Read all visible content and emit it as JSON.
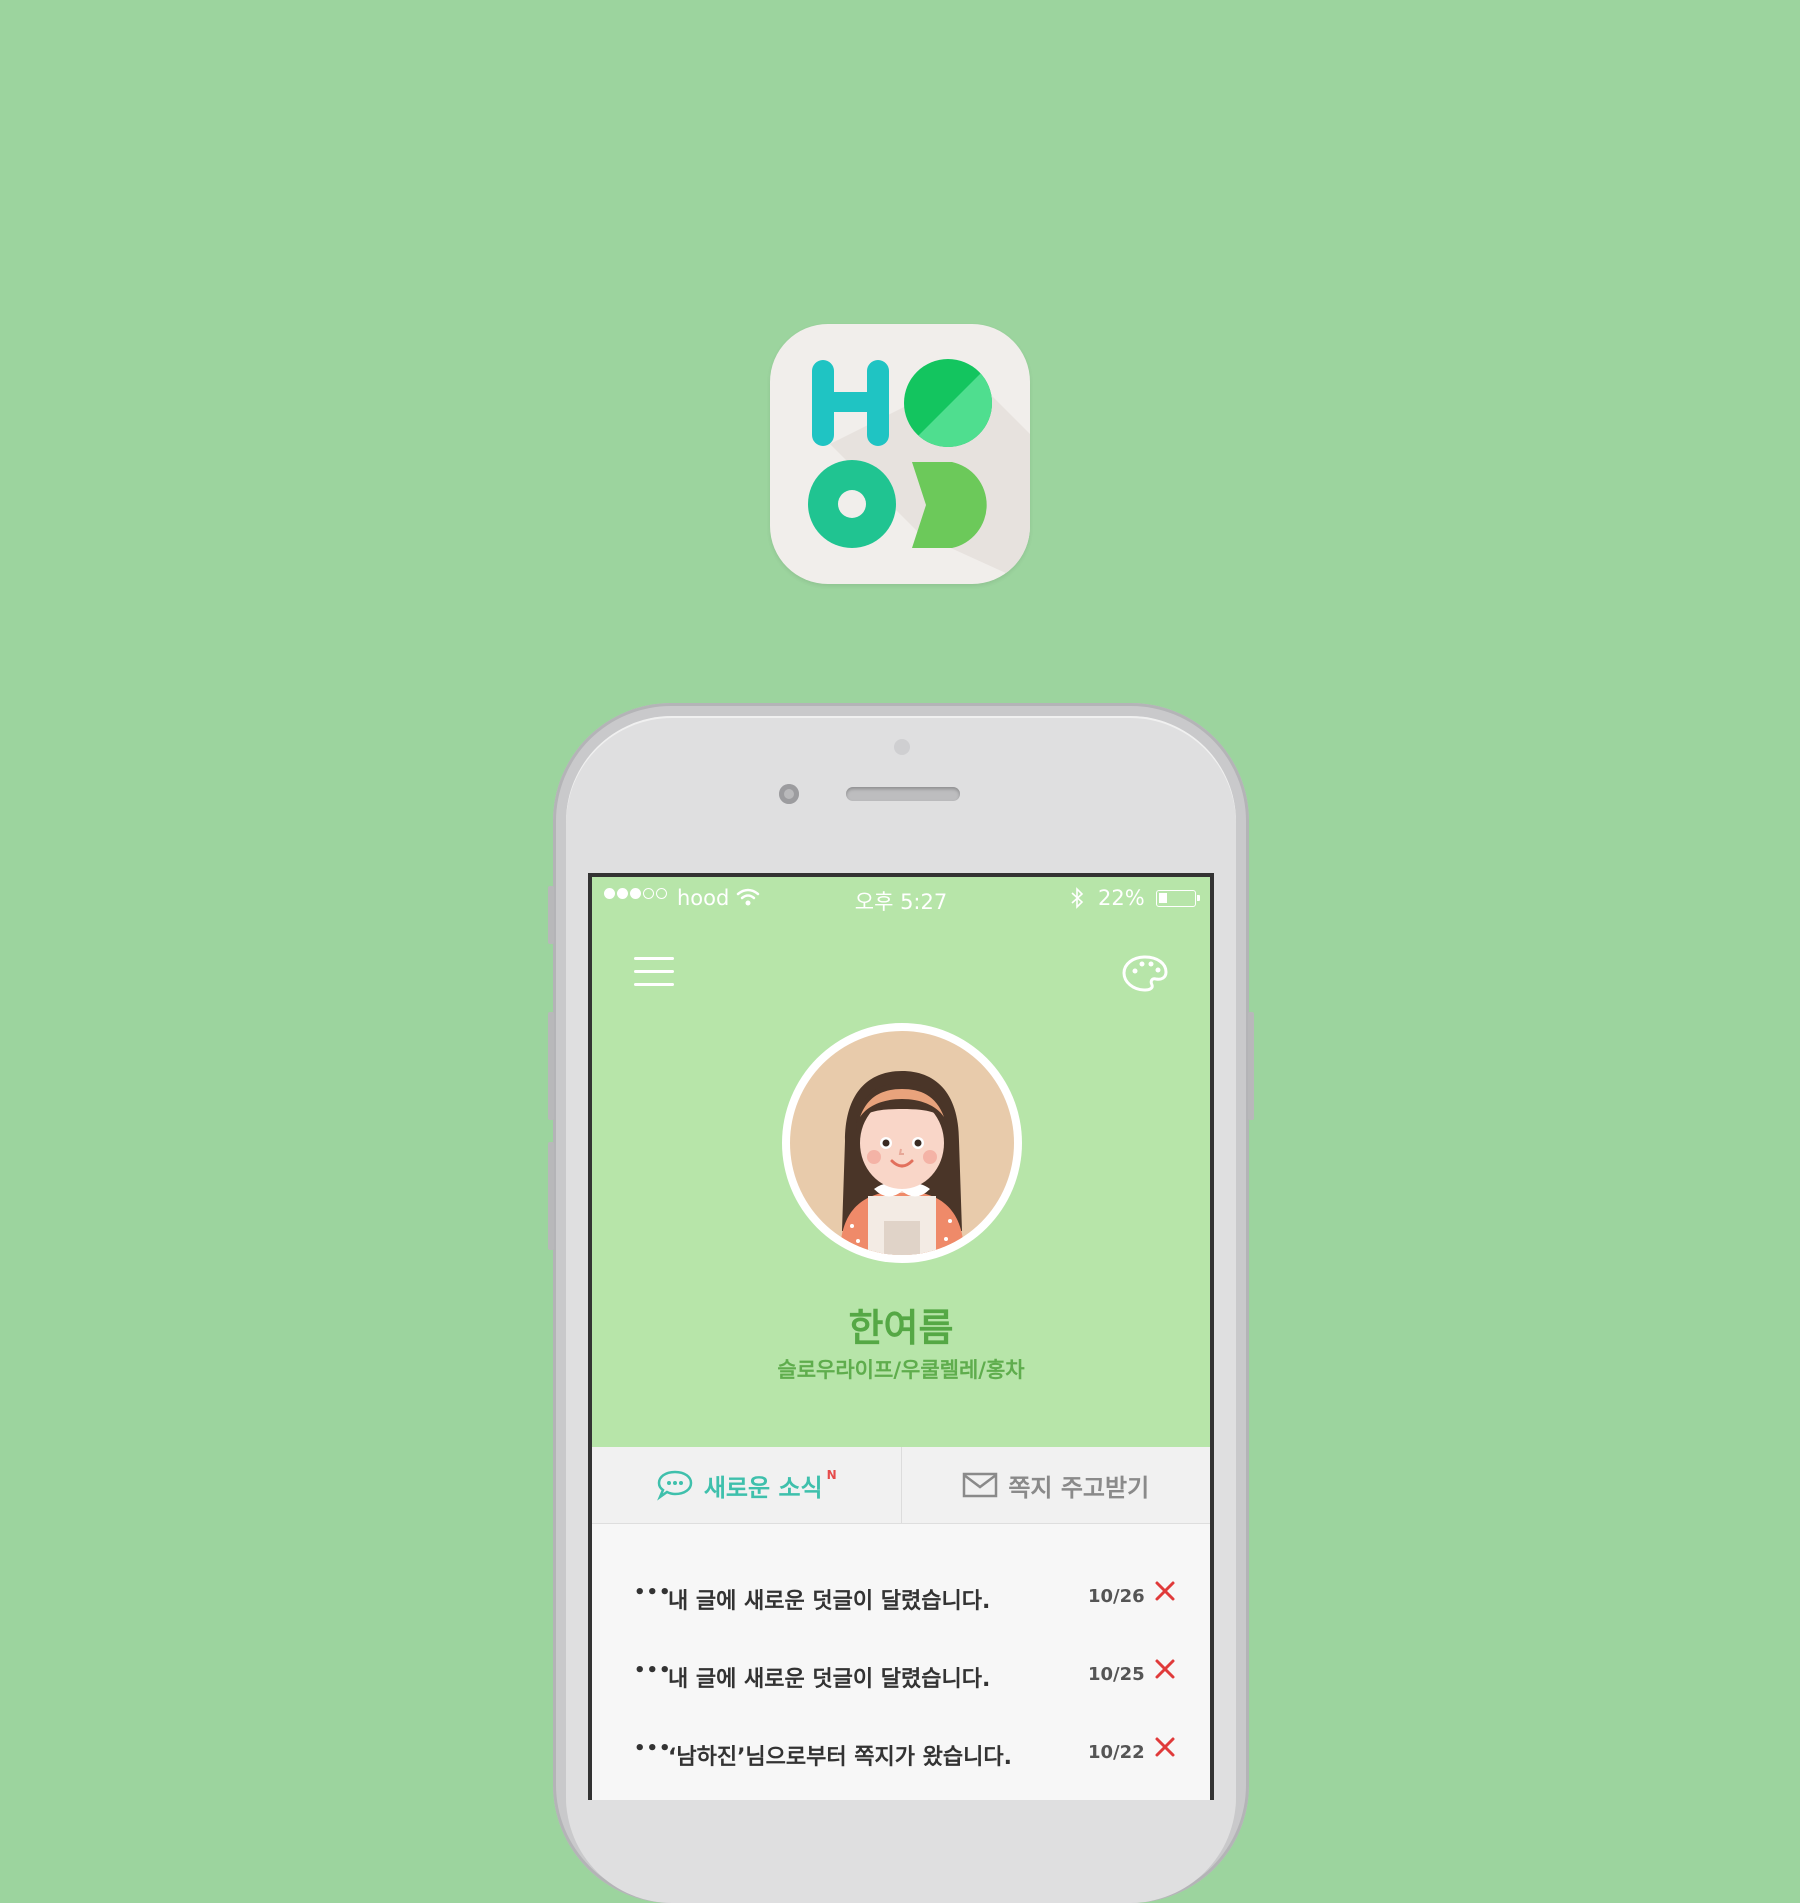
{
  "app_icon": {
    "letters": "HOOD",
    "colors": {
      "h": "#1fc4c3",
      "o_dark": "#13c55f",
      "o_light": "#4fde8f",
      "o2": "#20c491",
      "d": "#6cc95a"
    }
  },
  "status_bar": {
    "signal_dots": 5,
    "signal_filled": 3,
    "carrier": "hood",
    "time": "오후 5:27",
    "battery_percent": "22%"
  },
  "header": {
    "menu_icon": "hamburger-icon",
    "theme_icon": "palette-icon"
  },
  "profile": {
    "name": "한여름",
    "tags": "슬로우라이프/우쿨렐레/홍차"
  },
  "tabs": [
    {
      "label": "새로운 소식",
      "badge": "N",
      "icon": "chat-bubble-icon",
      "active": true
    },
    {
      "label": "쪽지 주고받기",
      "icon": "envelope-icon",
      "active": false
    }
  ],
  "notifications": [
    {
      "text": "내 글에 새로운 덧글이 달렸습니다.",
      "date": "10/26"
    },
    {
      "text": "내 글에 새로운 덧글이 달렸습니다.",
      "date": "10/25"
    },
    {
      "text": "‘남하진’님으로부터 쪽지가 왔습니다.",
      "date": "10/22"
    }
  ],
  "colors": {
    "background": "#9cd49e",
    "header_bg": "#b7e5a9",
    "accent": "#3fc0ac",
    "name_green": "#55a845",
    "delete_red": "#e03a3a"
  }
}
